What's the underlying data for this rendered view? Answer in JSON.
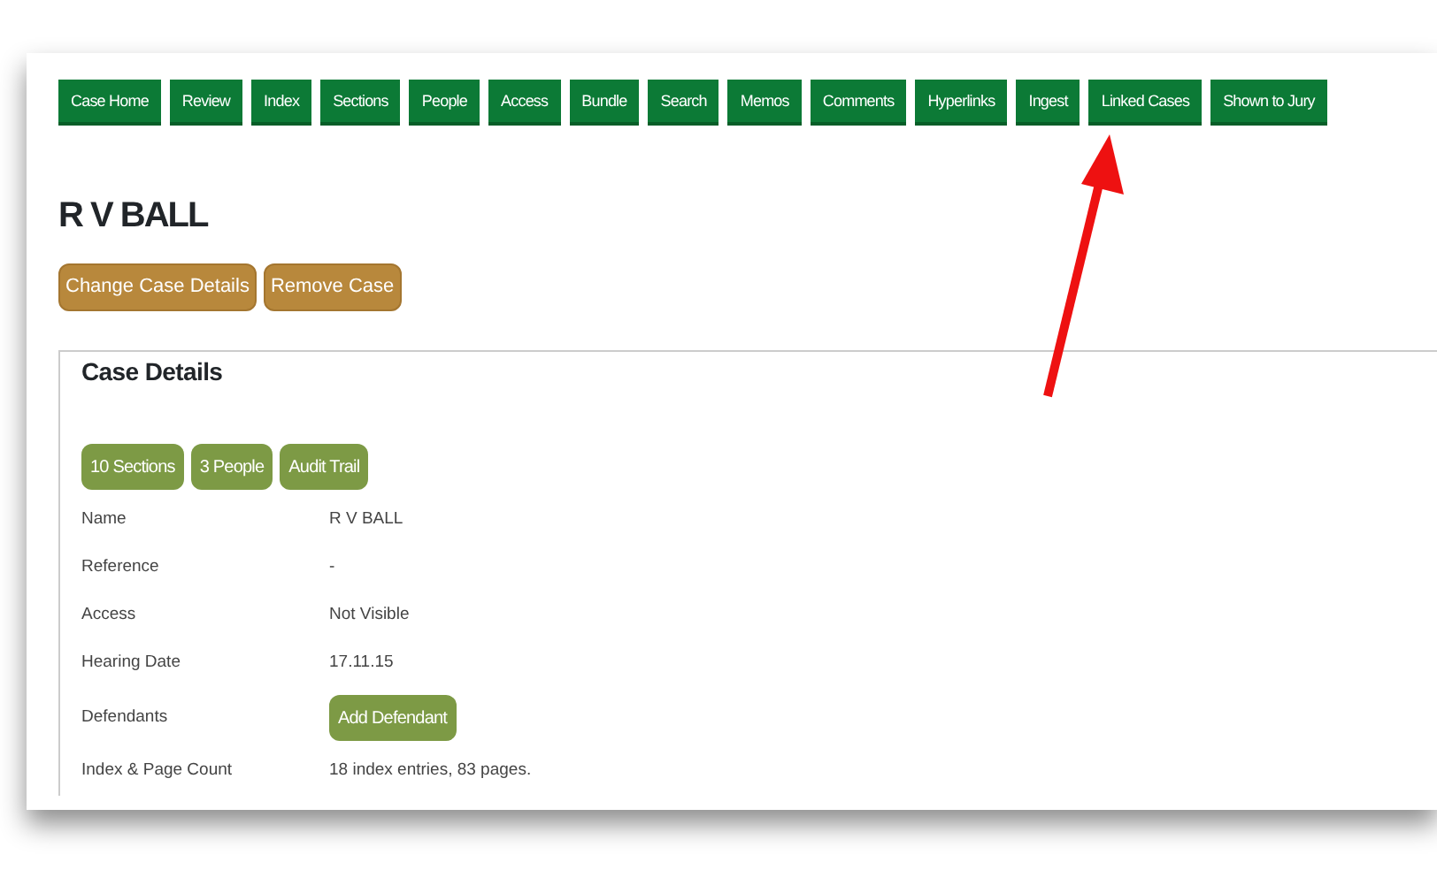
{
  "nav_tabs": [
    {
      "label": "Case Home"
    },
    {
      "label": "Review"
    },
    {
      "label": "Index"
    },
    {
      "label": "Sections"
    },
    {
      "label": "People"
    },
    {
      "label": "Access"
    },
    {
      "label": "Bundle"
    },
    {
      "label": "Search"
    },
    {
      "label": "Memos"
    },
    {
      "label": "Comments"
    },
    {
      "label": "Hyperlinks"
    },
    {
      "label": "Ingest"
    },
    {
      "label": "Linked Cases"
    },
    {
      "label": "Shown to Jury"
    }
  ],
  "case_title": "R V BALL",
  "case_actions": [
    "Change Case Details",
    "Remove Case"
  ],
  "case_details": {
    "legend": "Case Details",
    "summary_buttons": [
      "10 Sections",
      "3 People",
      "Audit Trail"
    ],
    "rows": [
      {
        "label": "Name",
        "kind": "text",
        "value": "R V BALL"
      },
      {
        "label": "Reference",
        "kind": "text",
        "value": "-"
      },
      {
        "label": "Access",
        "kind": "text",
        "value": "Not Visible"
      },
      {
        "label": "Hearing Date",
        "kind": "text",
        "value": "17.11.15"
      },
      {
        "label": "Defendants",
        "kind": "button",
        "value": "Add Defendant"
      },
      {
        "label": "Index & Page Count",
        "kind": "text",
        "value": "18 index entries, 83 pages."
      }
    ]
  }
}
